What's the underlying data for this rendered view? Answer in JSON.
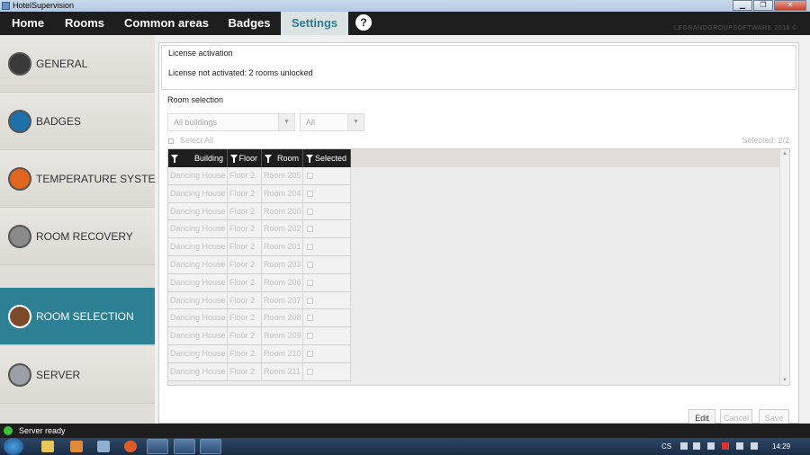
{
  "window": {
    "title": "HotelSupervision",
    "minimize": "▁",
    "restore": "❐",
    "close": "✕"
  },
  "nav": {
    "tabs": [
      "Home",
      "Rooms",
      "Common areas",
      "Badges",
      "Settings"
    ],
    "active_tab": "Settings",
    "help": "?",
    "brand": "LEGRANDGROUPSOFTWARE 2016 ©"
  },
  "sidebar": {
    "items": [
      {
        "label": "GENERAL",
        "icon": "gear-icon",
        "icon_color": "#3a3a3a"
      },
      {
        "label": "BADGES",
        "icon": "badge-icon",
        "icon_color": "#1f6fa8"
      },
      {
        "label": "TEMPERATURE SYSTEM",
        "icon": "thermometer-icon",
        "icon_color": "#e0651f"
      },
      {
        "label": "ROOM RECOVERY",
        "icon": "recovery-icon",
        "icon_color": "#8a8a8a"
      },
      {
        "label": "ROOM SELECTION",
        "icon": "door-icon",
        "icon_color": "#7a4a2a"
      },
      {
        "label": "SERVER",
        "icon": "server-icon",
        "icon_color": "#9aa0a6"
      }
    ],
    "active_index": 4
  },
  "license": {
    "title": "License activation",
    "status": "License not activated: 2 rooms unlocked"
  },
  "room_selection": {
    "title": "Room selection",
    "building_filter": "All buildings",
    "floor_filter": "All",
    "select_all": "Select All",
    "selected_count": "Selected: 2/2",
    "columns": [
      "Building",
      "Floor",
      "Room",
      "Selected"
    ],
    "rows": [
      [
        "Dancing House",
        "Floor 2",
        "Room 205"
      ],
      [
        "Dancing House",
        "Floor 2",
        "Room 204"
      ],
      [
        "Dancing House",
        "Floor 2",
        "Room 200"
      ],
      [
        "Dancing House",
        "Floor 2",
        "Room 202"
      ],
      [
        "Dancing House",
        "Floor 2",
        "Room 201"
      ],
      [
        "Dancing House",
        "Floor 2",
        "Room 203"
      ],
      [
        "Dancing House",
        "Floor 2",
        "Room 206"
      ],
      [
        "Dancing House",
        "Floor 2",
        "Room 207"
      ],
      [
        "Dancing House",
        "Floor 2",
        "Room 208"
      ],
      [
        "Dancing House",
        "Floor 2",
        "Room 209"
      ],
      [
        "Dancing House",
        "Floor 2",
        "Room 210"
      ],
      [
        "Dancing House",
        "Floor 2",
        "Room 211"
      ]
    ]
  },
  "buttons": {
    "edit": "Edit",
    "cancel": "Cancel",
    "save": "Save"
  },
  "status": {
    "text": "Server ready",
    "color": "#3cc33c"
  },
  "taskbar": {
    "language": "CS",
    "time": "14:29"
  },
  "colors": {
    "accent": "#2d7f93",
    "nav_bg": "#1e1e1e"
  }
}
